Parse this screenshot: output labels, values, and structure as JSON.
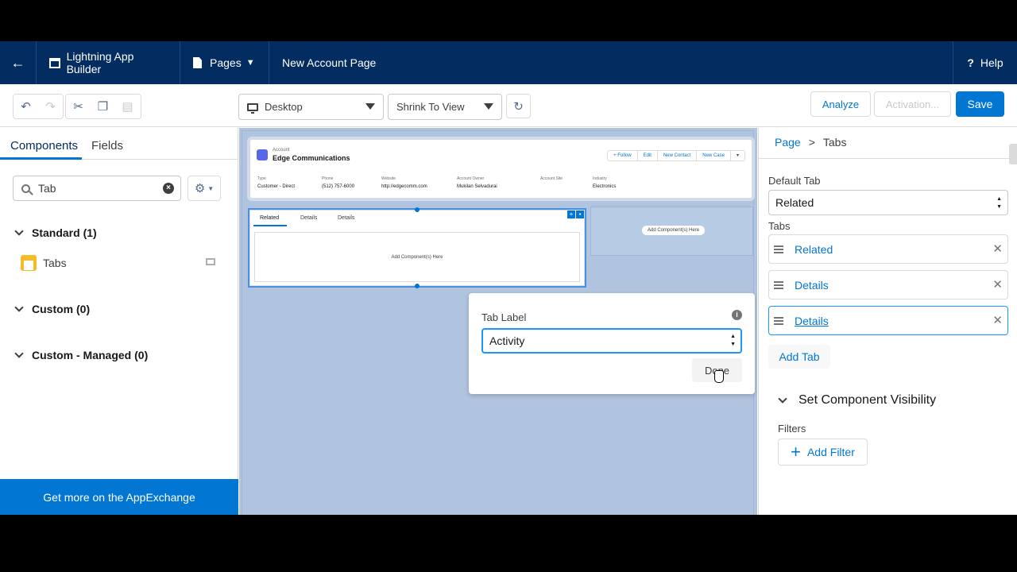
{
  "topbar": {
    "app_builder": "Lightning App Builder",
    "pages": "Pages",
    "page_name": "New Account Page",
    "help": "Help"
  },
  "toolbar": {
    "device": "Desktop",
    "view": "Shrink To View",
    "analyze": "Analyze",
    "activation": "Activation...",
    "save": "Save"
  },
  "left": {
    "tabs": [
      "Components",
      "Fields"
    ],
    "search_value": "Tab",
    "sections": [
      {
        "label": "Standard (1)"
      },
      {
        "label": "Custom (0)"
      },
      {
        "label": "Custom - Managed (0)"
      }
    ],
    "component": "Tabs",
    "appexchange": "Get more on the AppExchange"
  },
  "canvas": {
    "highlights": {
      "object": "Account",
      "name": "Edge Communications",
      "buttons": [
        "+ Follow",
        "Edit",
        "New Contact",
        "New Case",
        "▾"
      ],
      "fields": [
        {
          "label": "Type",
          "value": "Customer - Direct"
        },
        {
          "label": "Phone",
          "value": "(512) 757-6000"
        },
        {
          "label": "Website",
          "value": "http://edgecomm.com"
        },
        {
          "label": "Account Owner",
          "value": "Mukilan Selvadurai"
        },
        {
          "label": "Account Site",
          "value": ""
        },
        {
          "label": "Industry",
          "value": "Electronics"
        }
      ]
    },
    "tabs_component": {
      "tabs": [
        "Related",
        "Details",
        "Details"
      ],
      "placeholder": "Add Component(s) Here"
    },
    "empty_region": "Add Component(s) Here"
  },
  "popover": {
    "label": "Tab Label",
    "value": "Activity",
    "done": "Done"
  },
  "right": {
    "breadcrumb_page": "Page",
    "breadcrumb_sep": ">",
    "breadcrumb_current": "Tabs",
    "default_tab_label": "Default Tab",
    "default_tab_value": "Related",
    "tabs_label": "Tabs",
    "tabs": [
      {
        "name": "Related"
      },
      {
        "name": "Details"
      },
      {
        "name": "Details"
      }
    ],
    "add_tab": "Add Tab",
    "visibility": "Set Component Visibility",
    "filters": "Filters",
    "add_filter": "Add Filter"
  },
  "colors": {
    "header_bg": "#032d60",
    "brand": "#0176d3",
    "canvas_bg": "#b0c4df"
  }
}
